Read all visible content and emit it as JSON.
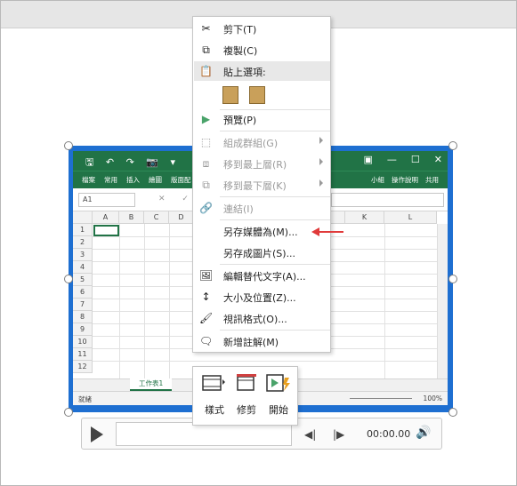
{
  "context_menu": {
    "items": [
      {
        "label": "剪下(T)",
        "icon": "scissors-icon",
        "disabled": false
      },
      {
        "label": "複製(C)",
        "icon": "copy-icon",
        "disabled": false
      },
      {
        "label": "貼上選項:",
        "icon": "paste-icon",
        "disabled": false
      },
      {
        "label": "預覽(P)",
        "icon": "play-preview-icon",
        "disabled": false
      },
      {
        "label": "組成群組(G)",
        "icon": "group-icon",
        "disabled": true
      },
      {
        "label": "移到最上層(R)",
        "icon": "bring-front-icon",
        "disabled": true
      },
      {
        "label": "移到最下層(K)",
        "icon": "send-back-icon",
        "disabled": true
      },
      {
        "label": "連結(I)",
        "icon": "link-icon",
        "disabled": true
      },
      {
        "label": "另存媒體為(M)...",
        "icon": "",
        "disabled": false
      },
      {
        "label": "另存成圖片(S)...",
        "icon": "",
        "disabled": false
      },
      {
        "label": "編輯替代文字(A)...",
        "icon": "alt-text-icon",
        "disabled": false
      },
      {
        "label": "大小及位置(Z)...",
        "icon": "size-position-icon",
        "disabled": false
      },
      {
        "label": "視訊格式(O)...",
        "icon": "video-format-icon",
        "disabled": false
      },
      {
        "label": "新增註解(M)",
        "icon": "comment-icon",
        "disabled": false
      }
    ]
  },
  "mini_toolbar": {
    "style_label": "樣式",
    "trim_label": "修剪",
    "start_label": "開始"
  },
  "media_controls": {
    "time": "00:00.00"
  },
  "excel": {
    "quick_access": "🖫 ↶ ↷ 📷 ▾",
    "window_controls": [
      "▣",
      "—",
      "☐",
      "✕"
    ],
    "ribbon_tabs": [
      "檔案",
      "常用",
      "插入",
      "繪圖",
      "版面配"
    ],
    "ribbon_right": [
      "小組",
      "操作說明",
      "共用"
    ],
    "name_box": "A1",
    "fx_icons": "✕ ✓",
    "columns": [
      "A",
      "B",
      "C",
      "D",
      "K",
      "L"
    ],
    "rows": [
      "1",
      "2",
      "3",
      "4",
      "5",
      "6",
      "7",
      "8",
      "9",
      "10",
      "11",
      "12"
    ],
    "sheet_tab": "工作表1",
    "status_ready": "就緒",
    "zoom": "100%"
  },
  "colors": {
    "excel_green": "#217346",
    "video_border": "#1e6fd1",
    "arrow": "#e03a3a"
  }
}
